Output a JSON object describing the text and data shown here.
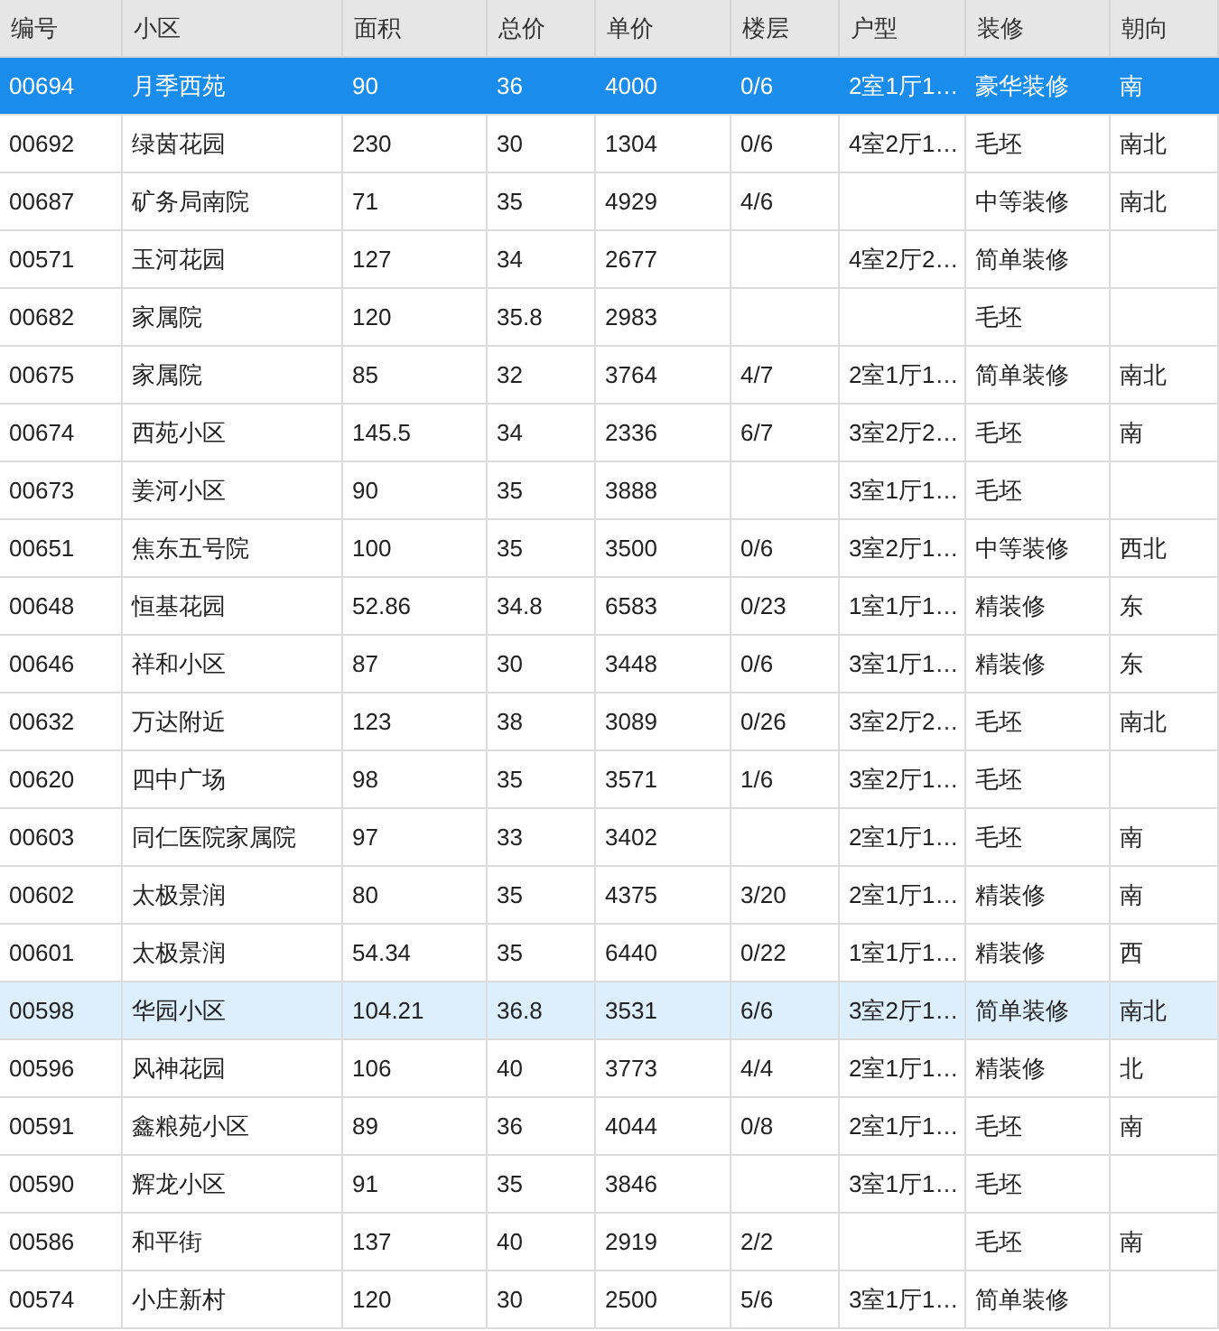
{
  "table": {
    "columns": [
      "编号",
      "小区",
      "面积",
      "总价",
      "单价",
      "楼层",
      "户型",
      "装修",
      "朝向"
    ],
    "rows": [
      {
        "selected": true,
        "highlighted": false,
        "cells": [
          "00694",
          "月季西苑",
          "90",
          "36",
          "4000",
          "0/6",
          "2室1厅1…",
          "豪华装修",
          "南"
        ]
      },
      {
        "selected": false,
        "highlighted": false,
        "cells": [
          "00692",
          "绿茵花园",
          "230",
          "30",
          "1304",
          "0/6",
          "4室2厅1…",
          "毛坯",
          "南北"
        ]
      },
      {
        "selected": false,
        "highlighted": false,
        "cells": [
          "00687",
          "矿务局南院",
          "71",
          "35",
          "4929",
          "4/6",
          null,
          "中等装修",
          "南北"
        ]
      },
      {
        "selected": false,
        "highlighted": false,
        "cells": [
          "00571",
          "玉河花园",
          "127",
          "34",
          "2677",
          null,
          "4室2厅2…",
          "简单装修",
          null
        ]
      },
      {
        "selected": false,
        "highlighted": false,
        "cells": [
          "00682",
          "家属院",
          "120",
          "35.8",
          "2983",
          null,
          null,
          "毛坯",
          null
        ]
      },
      {
        "selected": false,
        "highlighted": false,
        "cells": [
          "00675",
          "家属院",
          "85",
          "32",
          "3764",
          "4/7",
          "2室1厅1…",
          "简单装修",
          "南北"
        ]
      },
      {
        "selected": false,
        "highlighted": false,
        "cells": [
          "00674",
          "西苑小区",
          "145.5",
          "34",
          "2336",
          "6/7",
          "3室2厅2…",
          "毛坯",
          "南"
        ]
      },
      {
        "selected": false,
        "highlighted": false,
        "cells": [
          "00673",
          "姜河小区",
          "90",
          "35",
          "3888",
          null,
          "3室1厅1…",
          "毛坯",
          null
        ]
      },
      {
        "selected": false,
        "highlighted": false,
        "cells": [
          "00651",
          "焦东五号院",
          "100",
          "35",
          "3500",
          "0/6",
          "3室2厅1…",
          "中等装修",
          "西北"
        ]
      },
      {
        "selected": false,
        "highlighted": false,
        "cells": [
          "00648",
          "恒基花园",
          "52.86",
          "34.8",
          "6583",
          "0/23",
          "1室1厅1…",
          "精装修",
          "东"
        ]
      },
      {
        "selected": false,
        "highlighted": false,
        "cells": [
          "00646",
          "祥和小区",
          "87",
          "30",
          "3448",
          "0/6",
          "3室1厅1…",
          "精装修",
          "东"
        ]
      },
      {
        "selected": false,
        "highlighted": false,
        "cells": [
          "00632",
          "万达附近",
          "123",
          "38",
          "3089",
          "0/26",
          "3室2厅2…",
          "毛坯",
          "南北"
        ]
      },
      {
        "selected": false,
        "highlighted": false,
        "cells": [
          "00620",
          "四中广场",
          "98",
          "35",
          "3571",
          "1/6",
          "3室2厅1…",
          "毛坯",
          null
        ]
      },
      {
        "selected": false,
        "highlighted": false,
        "cells": [
          "00603",
          "同仁医院家属院",
          "97",
          "33",
          "3402",
          null,
          "2室1厅1…",
          "毛坯",
          "南"
        ]
      },
      {
        "selected": false,
        "highlighted": false,
        "cells": [
          "00602",
          "太极景润",
          "80",
          "35",
          "4375",
          "3/20",
          "2室1厅1…",
          "精装修",
          "南"
        ]
      },
      {
        "selected": false,
        "highlighted": false,
        "cells": [
          "00601",
          "太极景润",
          "54.34",
          "35",
          "6440",
          "0/22",
          "1室1厅1…",
          "精装修",
          "西"
        ]
      },
      {
        "selected": false,
        "highlighted": true,
        "cells": [
          "00598",
          "华园小区",
          "104.21",
          "36.8",
          "3531",
          "6/6",
          "3室2厅1…",
          "简单装修",
          "南北"
        ]
      },
      {
        "selected": false,
        "highlighted": false,
        "cells": [
          "00596",
          "风神花园",
          "106",
          "40",
          "3773",
          "4/4",
          "2室1厅1…",
          "精装修",
          "北"
        ]
      },
      {
        "selected": false,
        "highlighted": false,
        "cells": [
          "00591",
          "鑫粮苑小区",
          "89",
          "36",
          "4044",
          "0/8",
          "2室1厅1…",
          "毛坯",
          "南"
        ]
      },
      {
        "selected": false,
        "highlighted": false,
        "cells": [
          "00590",
          "辉龙小区",
          "91",
          "35",
          "3846",
          null,
          "3室1厅1…",
          "毛坯",
          null
        ]
      },
      {
        "selected": false,
        "highlighted": false,
        "cells": [
          "00586",
          "和平街",
          "137",
          "40",
          "2919",
          "2/2",
          null,
          "毛坯",
          "南"
        ]
      },
      {
        "selected": false,
        "highlighted": false,
        "cells": [
          "00574",
          "小庄新村",
          "120",
          "30",
          "2500",
          "5/6",
          "3室1厅1…",
          "简单装修",
          null
        ]
      }
    ]
  }
}
